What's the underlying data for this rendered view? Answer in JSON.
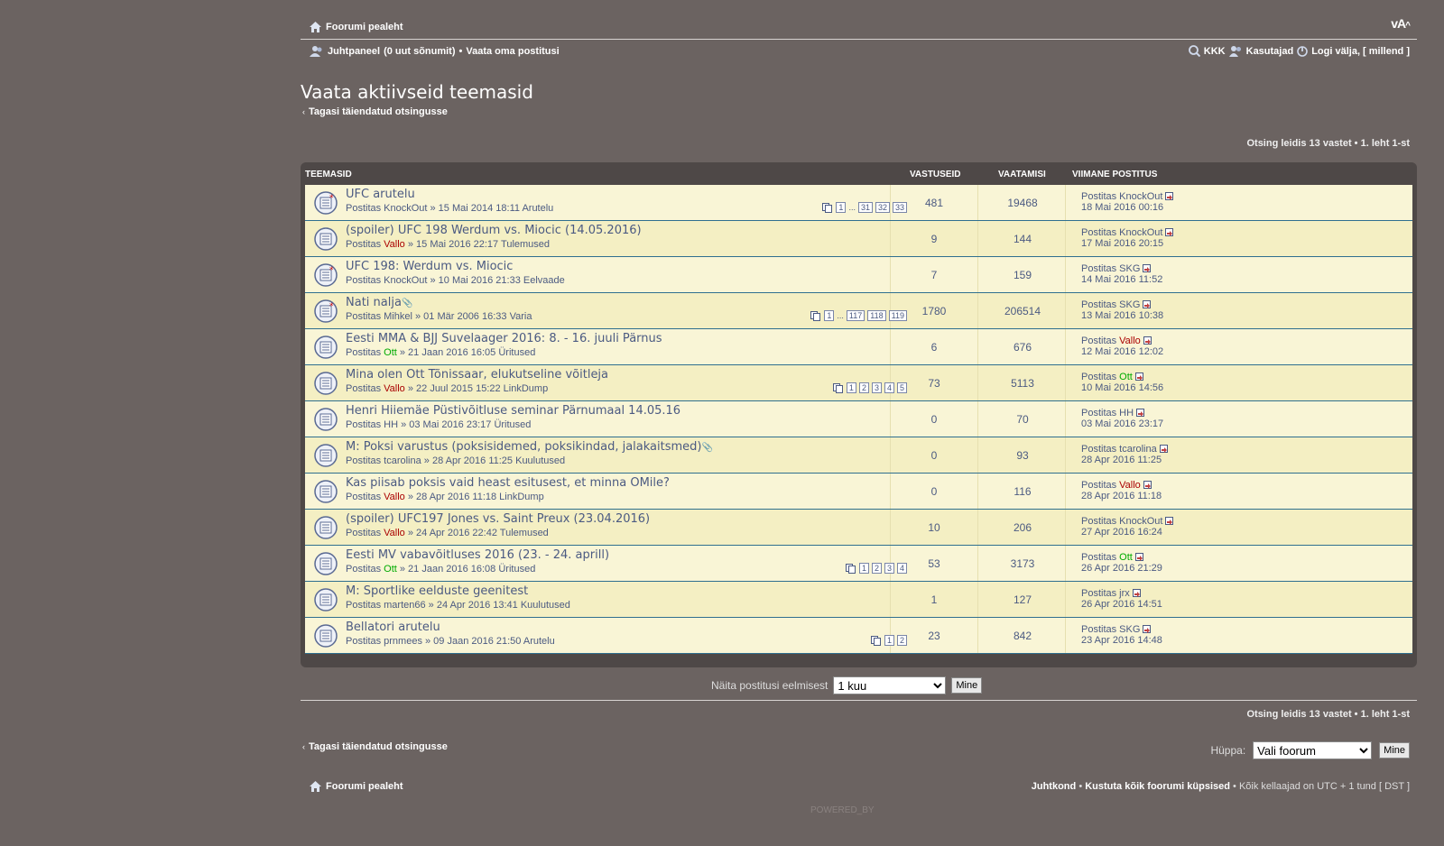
{
  "header": {
    "board_index": "Foorumi pealeht",
    "font_size_icon": "font-size-icon",
    "ucp_label": "Juhtpaneel",
    "new_messages": "(0 uut sõnumit)",
    "separator": "•",
    "own_posts": "Vaata oma postitusi",
    "faq": "KKK",
    "members": "Kasutajad",
    "logout": "Logi välja, [ millend ]"
  },
  "page": {
    "title": "Vaata aktiivseid teemasid",
    "back_link": "Tagasi täiendatud otsingusse",
    "search_info": "Otsing leidis 13 vastet • 1. leht 1-st"
  },
  "table": {
    "headers": [
      "TEEMASID",
      "VASTUSEID",
      "VAATAMISI",
      "VIIMANE POSTITUS"
    ],
    "rows": [
      {
        "title": "UFC arutelu",
        "by": "Postitas",
        "author": "KnockOut",
        "author_color": "",
        "meta": " » 15 Mai 2014 18:11 Arutelu",
        "pages": [
          "1",
          "...",
          "31",
          "32",
          "33"
        ],
        "replies": "481",
        "views": "19468",
        "lp_by": "Postitas",
        "lp_author": "KnockOut",
        "lp_color": "",
        "lp_date": "18 Mai 2016 00:16",
        "hot": true,
        "attach": false
      },
      {
        "title": "(spoiler) UFC 198 Werdum vs. Miocic (14.05.2016)",
        "by": "Postitas",
        "author": "Vallo",
        "author_color": "red",
        "meta": " » 15 Mai 2016 22:17 Tulemused",
        "pages": [],
        "replies": "9",
        "views": "144",
        "lp_by": "Postitas",
        "lp_author": "KnockOut",
        "lp_color": "",
        "lp_date": "17 Mai 2016 20:15",
        "hot": false,
        "attach": false
      },
      {
        "title": "UFC 198: Werdum vs. Miocic",
        "by": "Postitas",
        "author": "KnockOut",
        "author_color": "",
        "meta": " » 10 Mai 2016 21:33 Eelvaade",
        "pages": [],
        "replies": "7",
        "views": "159",
        "lp_by": "Postitas",
        "lp_author": "SKG",
        "lp_color": "",
        "lp_date": "14 Mai 2016 11:52",
        "hot": true,
        "attach": false
      },
      {
        "title": "Nati nalja",
        "by": "Postitas",
        "author": "Mihkel",
        "author_color": "",
        "meta": " » 01 Mär 2006 16:33 Varia",
        "pages": [
          "1",
          "...",
          "117",
          "118",
          "119"
        ],
        "replies": "1780",
        "views": "206514",
        "lp_by": "Postitas",
        "lp_author": "SKG",
        "lp_color": "",
        "lp_date": "13 Mai 2016 10:38",
        "hot": true,
        "attach": true
      },
      {
        "title": "Eesti MMA & BJJ Suvelaager 2016: 8. - 16. juuli Pärnus",
        "by": "Postitas",
        "author": "Ott",
        "author_color": "green",
        "meta": " » 21 Jaan 2016 16:05 Üritused",
        "pages": [],
        "replies": "6",
        "views": "676",
        "lp_by": "Postitas",
        "lp_author": "Vallo",
        "lp_color": "red",
        "lp_date": "12 Mai 2016 12:02",
        "hot": false,
        "attach": false
      },
      {
        "title": "Mina olen Ott Tõnissaar, elukutseline võitleja",
        "by": "Postitas",
        "author": "Vallo",
        "author_color": "red",
        "meta": " » 22 Juul 2015 15:22 LinkDump",
        "pages": [
          "1",
          "2",
          "3",
          "4",
          "5"
        ],
        "replies": "73",
        "views": "5113",
        "lp_by": "Postitas",
        "lp_author": "Ott",
        "lp_color": "green",
        "lp_date": "10 Mai 2016 14:56",
        "hot": false,
        "attach": false
      },
      {
        "title": "Henri Hiiemäe Püstivõitluse seminar Pärnumaal 14.05.16",
        "by": "Postitas",
        "author": "HH",
        "author_color": "",
        "meta": " » 03 Mai 2016 23:17 Üritused",
        "pages": [],
        "replies": "0",
        "views": "70",
        "lp_by": "Postitas",
        "lp_author": "HH",
        "lp_color": "",
        "lp_date": "03 Mai 2016 23:17",
        "hot": false,
        "attach": false
      },
      {
        "title": "M: Poksi varustus (poksisidemed, poksikindad, jalakaitsmed)",
        "by": "Postitas",
        "author": "tcarolina",
        "author_color": "",
        "meta": " » 28 Apr 2016 11:25 Kuulutused",
        "pages": [],
        "replies": "0",
        "views": "93",
        "lp_by": "Postitas",
        "lp_author": "tcarolina",
        "lp_color": "",
        "lp_date": "28 Apr 2016 11:25",
        "hot": false,
        "attach": true
      },
      {
        "title": "Kas piisab poksis vaid heast esitusest, et minna OMile?",
        "by": "Postitas",
        "author": "Vallo",
        "author_color": "red",
        "meta": " » 28 Apr 2016 11:18 LinkDump",
        "pages": [],
        "replies": "0",
        "views": "116",
        "lp_by": "Postitas",
        "lp_author": "Vallo",
        "lp_color": "red",
        "lp_date": "28 Apr 2016 11:18",
        "hot": false,
        "attach": false
      },
      {
        "title": "(spoiler) UFC197 Jones vs. Saint Preux (23.04.2016)",
        "by": "Postitas",
        "author": "Vallo",
        "author_color": "red",
        "meta": " » 24 Apr 2016 22:42 Tulemused",
        "pages": [],
        "replies": "10",
        "views": "206",
        "lp_by": "Postitas",
        "lp_author": "KnockOut",
        "lp_color": "",
        "lp_date": "27 Apr 2016 16:24",
        "hot": false,
        "attach": false
      },
      {
        "title": "Eesti MV vabavõitluses 2016 (23. - 24. aprill)",
        "by": "Postitas",
        "author": "Ott",
        "author_color": "green",
        "meta": " » 21 Jaan 2016 16:08 Üritused",
        "pages": [
          "1",
          "2",
          "3",
          "4"
        ],
        "replies": "53",
        "views": "3173",
        "lp_by": "Postitas",
        "lp_author": "Ott",
        "lp_color": "green",
        "lp_date": "26 Apr 2016 21:29",
        "hot": false,
        "attach": false
      },
      {
        "title": "M: Sportlike eelduste geenitest",
        "by": "Postitas",
        "author": "marten66",
        "author_color": "",
        "meta": " » 24 Apr 2016 13:41 Kuulutused",
        "pages": [],
        "replies": "1",
        "views": "127",
        "lp_by": "Postitas",
        "lp_author": "jrx",
        "lp_color": "",
        "lp_date": "26 Apr 2016 14:51",
        "hot": false,
        "attach": false
      },
      {
        "title": "Bellatori arutelu",
        "by": "Postitas",
        "author": "prnmees",
        "author_color": "",
        "meta": " » 09 Jaan 2016 21:50 Arutelu",
        "pages": [
          "1",
          "2"
        ],
        "replies": "23",
        "views": "842",
        "lp_by": "Postitas",
        "lp_author": "SKG",
        "lp_color": "",
        "lp_date": "23 Apr 2016 14:48",
        "hot": false,
        "attach": false
      }
    ]
  },
  "controls": {
    "show_label": "Näita postitusi eelmisest",
    "show_value": "1 kuu",
    "go_label": "Mine",
    "jump_label": "Hüppa:",
    "jump_value": "Vali foorum"
  },
  "footer": {
    "board_index": "Foorumi pealeht",
    "team": "Juhtkond",
    "delete_cookies": "Kustuta kõik foorumi küpsised",
    "timezone": "Kõik kellaajad on UTC + 1 tund [ DST ]",
    "powered": "POWERED_BY"
  }
}
